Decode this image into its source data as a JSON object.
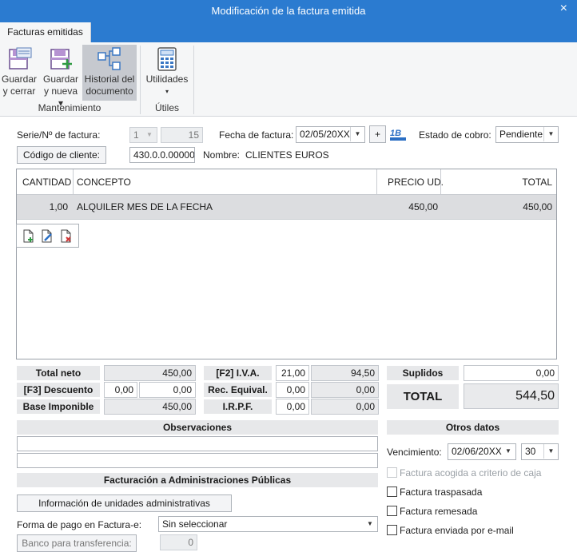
{
  "window": {
    "title": "Modificación de la factura emitida",
    "close": "×"
  },
  "ribbon": {
    "tab": "Facturas emitidas",
    "buttons": {
      "save_close": [
        "Guardar",
        "y cerrar"
      ],
      "save_new": [
        "Guardar",
        "y nueva ▾"
      ],
      "history": [
        "Historial del",
        "documento"
      ],
      "utilities": [
        "Utilidades",
        "▾"
      ]
    },
    "groups": {
      "maintenance": "Mantenimiento",
      "tools": "Útiles"
    }
  },
  "header": {
    "invoice_number_label": "Serie/Nº de factura:",
    "series": "1",
    "number": "15",
    "date_label": "Fecha de factura:",
    "date": "02/05/20XX",
    "plus": "+",
    "status_label": "Estado de cobro:",
    "status": "Pendiente",
    "client_code_button": "Código de cliente:",
    "client_code": "430.0.0.00000",
    "name_label": "Nombre:",
    "name": "CLIENTES EUROS"
  },
  "table": {
    "columns": [
      "CANTIDAD",
      "CONCEPTO",
      "PRECIO UD.",
      "TOTAL"
    ],
    "rows": [
      {
        "qty": "1,00",
        "concept": "ALQUILER MES DE LA FECHA",
        "price": "450,00",
        "total": "450,00"
      }
    ]
  },
  "totals": {
    "net_label": "Total neto",
    "net": "450,00",
    "discount_label": "[F3] Descuento",
    "discount_pct": "0,00",
    "discount_amount": "0,00",
    "base_label": "Base Imponible",
    "base": "450,00",
    "vat_label": "[F2] I.V.A.",
    "vat_pct": "21,00",
    "vat_amount": "94,50",
    "req_label": "Rec. Equival.",
    "req_pct": "0,00",
    "req_amount": "0,00",
    "irpf_label": "I.R.P.F.",
    "irpf_pct": "0,00",
    "irpf_amount": "0,00",
    "supplies_label": "Suplidos",
    "supplies": "0,00",
    "total_label": "TOTAL",
    "total": "544,50"
  },
  "observations": {
    "label": "Observaciones",
    "line1": "",
    "line2": ""
  },
  "public_admin": {
    "label": "Facturación a Administraciones Públicas",
    "units_button": "Información de unidades administrativas",
    "payment_label": "Forma de pago en Factura-e:",
    "payment_value": "Sin seleccionar",
    "bank_button": "Banco para transferencia:",
    "bank_value": "0"
  },
  "other": {
    "label": "Otros datos",
    "due_label": "Vencimiento:",
    "due_date": "02/06/20XX",
    "due_days": "30",
    "cash_criterion": "Factura acogida a criterio de caja",
    "transferred": "Factura traspasada",
    "remitted": "Factura remesada",
    "emailed": "Factura enviada por e-mail"
  },
  "colors": {
    "titlebar": "#2b7bd0",
    "ribbon": "#f5f6f7",
    "selected_row": "#dcdde0"
  }
}
